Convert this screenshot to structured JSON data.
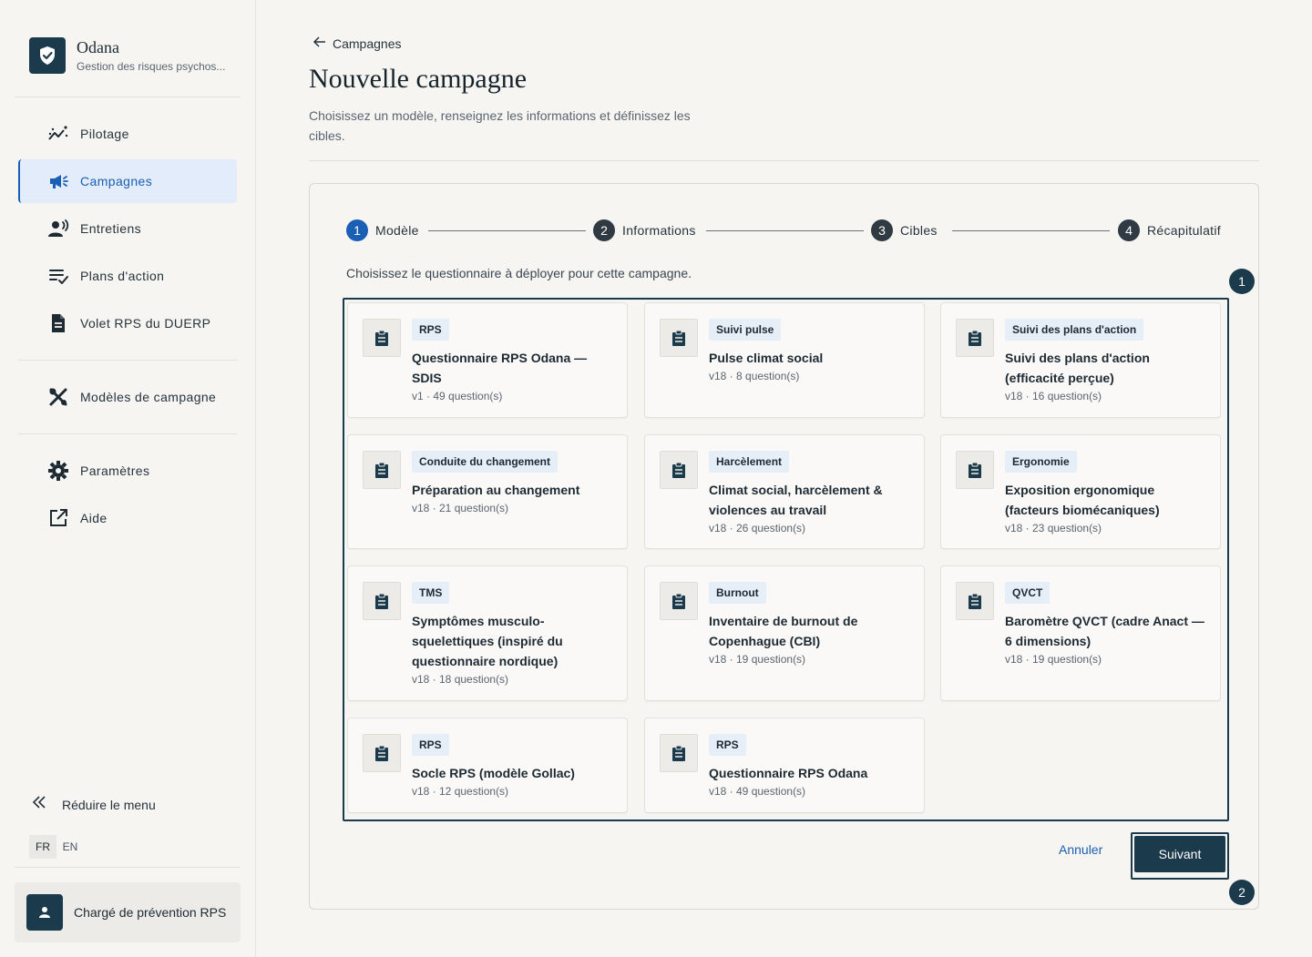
{
  "brand": {
    "name": "Odana",
    "subtitle": "Gestion des risques psychos..."
  },
  "sidebar": {
    "items": [
      {
        "label": "Pilotage",
        "icon": "chart-line-icon",
        "active": false
      },
      {
        "label": "Campagnes",
        "icon": "megaphone-icon",
        "active": true
      },
      {
        "label": "Entretiens",
        "icon": "person-speaking-icon",
        "active": false
      },
      {
        "label": "Plans d'action",
        "icon": "checklist-icon",
        "active": false
      },
      {
        "label": "Volet RPS du DUERP",
        "icon": "document-icon",
        "active": false
      },
      {
        "label": "Modèles de campagne",
        "icon": "tools-icon",
        "active": false
      },
      {
        "label": "Paramètres",
        "icon": "gear-icon",
        "active": false
      },
      {
        "label": "Aide",
        "icon": "external-link-icon",
        "active": false
      }
    ],
    "collapse_label": "Réduire le menu",
    "languages": [
      "FR",
      "EN"
    ],
    "selected_language": "FR",
    "user_role": "Chargé de prévention RPS"
  },
  "header": {
    "back_label": "Campagnes",
    "title": "Nouvelle campagne",
    "description": "Choisissez un modèle, renseignez les informations et définissez les cibles."
  },
  "stepper": [
    {
      "num": "1",
      "label": "Modèle",
      "active": true
    },
    {
      "num": "2",
      "label": "Informations",
      "active": false
    },
    {
      "num": "3",
      "label": "Cibles",
      "active": false
    },
    {
      "num": "4",
      "label": "Récapitulatif",
      "active": false
    }
  ],
  "instruction": "Choisissez le questionnaire à déployer pour cette campagne.",
  "markers": [
    "1",
    "2"
  ],
  "templates": [
    {
      "tag": "RPS",
      "title": "Questionnaire RPS Odana — SDIS",
      "meta": "v1 · 49 question(s)"
    },
    {
      "tag": "Suivi pulse",
      "title": "Pulse climat social",
      "meta": "v18 · 8 question(s)"
    },
    {
      "tag": "Suivi des plans d'action",
      "title": "Suivi des plans d'action (efficacité perçue)",
      "meta": "v18 · 16 question(s)"
    },
    {
      "tag": "Conduite du changement",
      "title": "Préparation au changement",
      "meta": "v18 · 21 question(s)"
    },
    {
      "tag": "Harcèlement",
      "title": "Climat social, harcèlement & violences au travail",
      "meta": "v18 · 26 question(s)"
    },
    {
      "tag": "Ergonomie",
      "title": "Exposition ergonomique (facteurs biomécaniques)",
      "meta": "v18 · 23 question(s)"
    },
    {
      "tag": "TMS",
      "title": "Symptômes musculo-squelettiques (inspiré du questionnaire nordique)",
      "meta": "v18 · 18 question(s)"
    },
    {
      "tag": "Burnout",
      "title": "Inventaire de burnout de Copenhague (CBI)",
      "meta": "v18 · 19 question(s)"
    },
    {
      "tag": "QVCT",
      "title": "Baromètre QVCT (cadre Anact — 6 dimensions)",
      "meta": "v18 · 19 question(s)"
    },
    {
      "tag": "RPS",
      "title": "Socle RPS (modèle Gollac)",
      "meta": "v18 · 12 question(s)"
    },
    {
      "tag": "RPS",
      "title": "Questionnaire RPS Odana",
      "meta": "v18 · 49 question(s)"
    }
  ],
  "actions": {
    "cancel": "Annuler",
    "next": "Suivant"
  },
  "colors": {
    "primary": "#1b3a4b",
    "accent": "#1a5fb4",
    "active_bg": "#e2ecfa",
    "tag_bg": "#e6eef8",
    "page_bg": "#f6f5f2"
  }
}
